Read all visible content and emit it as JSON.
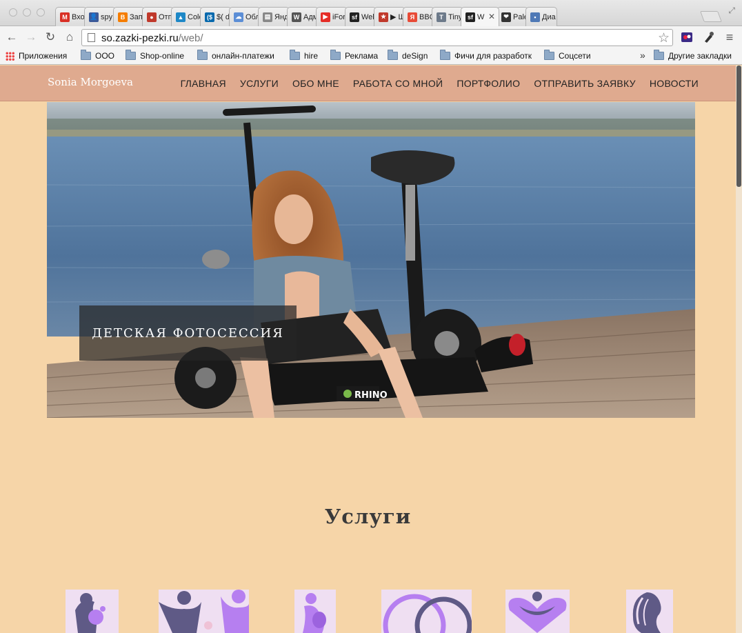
{
  "browser": {
    "tabs": [
      {
        "title": "Вхо",
        "favicon": "gmail-icon",
        "color": "#d93025",
        "glyph": "M"
      },
      {
        "title": "spy",
        "favicon": "person-icon",
        "color": "#3b5998",
        "glyph": "👤"
      },
      {
        "title": "Запі",
        "favicon": "blogger-icon",
        "color": "#f57d00",
        "glyph": "B"
      },
      {
        "title": "Отп",
        "favicon": "mail-icon",
        "color": "#c0392b",
        "glyph": "●"
      },
      {
        "title": "Colo",
        "favicon": "colorlib-icon",
        "color": "#1e88c7",
        "glyph": "▲"
      },
      {
        "title": "$( d",
        "favicon": "jquery-icon",
        "color": "#0769ad",
        "glyph": "($"
      },
      {
        "title": "Обл",
        "favicon": "cloud-icon",
        "color": "#5c8ed6",
        "glyph": "☁"
      },
      {
        "title": "Янд",
        "favicon": "document-icon",
        "color": "#888888",
        "glyph": "▤"
      },
      {
        "title": "Адм",
        "favicon": "wordpress-icon",
        "color": "#555555",
        "glyph": "W"
      },
      {
        "title": "iFor",
        "favicon": "youtube-icon",
        "color": "#e52d27",
        "glyph": "▶"
      },
      {
        "title": "Welc",
        "favicon": "symfony-icon",
        "color": "#222222",
        "glyph": "sf"
      },
      {
        "title": "▶ Ш",
        "favicon": "star-icon",
        "color": "#c0392b",
        "glyph": "★"
      },
      {
        "title": "BBC",
        "favicon": "yandex-icon",
        "color": "#e84b37",
        "glyph": "Я"
      },
      {
        "title": "Tiny",
        "favicon": "tinymce-icon",
        "color": "#6d7a8a",
        "glyph": "T"
      },
      {
        "title": "W",
        "favicon": "symfony-icon",
        "color": "#222222",
        "glyph": "sf",
        "active": true
      },
      {
        "title": "Pale",
        "favicon": "heart-icon",
        "color": "#333333",
        "glyph": "❤"
      },
      {
        "title": "Диа",
        "favicon": "chat-icon",
        "color": "#4f79b6",
        "glyph": "▪"
      }
    ],
    "url_host": "so.zazki-pezki.ru",
    "url_path": "/web/",
    "bookmarks": [
      {
        "label": "Приложения",
        "icon": "apps-icon"
      },
      {
        "label": "ООО",
        "icon": "folder-icon"
      },
      {
        "label": "Shop-online",
        "icon": "folder-icon"
      },
      {
        "label": "онлайн-платежи",
        "icon": "folder-icon"
      },
      {
        "label": "hire",
        "icon": "folder-icon"
      },
      {
        "label": "Реклама",
        "icon": "folder-icon"
      },
      {
        "label": "deSign",
        "icon": "folder-icon"
      },
      {
        "label": "Фичи для разработк",
        "icon": "folder-icon"
      },
      {
        "label": "Соцсети",
        "icon": "folder-icon"
      }
    ],
    "bookmarks_more": "»",
    "other_bookmarks": "Другие закладки"
  },
  "site": {
    "brand": "Sonia Morgoeva",
    "nav": [
      "ГЛАВНАЯ",
      "УСЛУГИ",
      "ОБО МНЕ",
      "РАБОТА СО МНОЙ",
      "ПОРТФОЛИО",
      "ОТПРАВИТЬ ЗАЯВКУ",
      "НОВОСТИ"
    ],
    "hero_caption": "ДЕТСКАЯ ФОТОСЕССИЯ",
    "scooter_brand": "RHINO",
    "services_title": "Услуги",
    "service_icons": [
      "mother-child-icon",
      "family-icon",
      "pregnancy-icon",
      "wedding-rings-icon",
      "heart-family-icon",
      "woman-profile-icon"
    ],
    "colors": {
      "page_bg": "#f6d5a8",
      "header_bg": "#dfaa8f",
      "icon_purple": "#b67ff0",
      "icon_slate": "#5f5a86"
    }
  }
}
